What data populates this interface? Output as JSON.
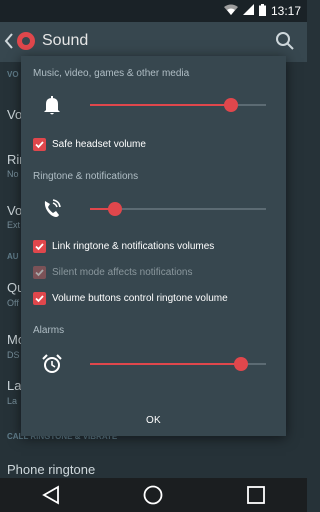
{
  "status_bar": {
    "time": "13:17"
  },
  "app_bar": {
    "title": "Sound"
  },
  "background_list": {
    "items": [
      {
        "label": "Vo",
        "top": 0
      },
      {
        "label": "Rin",
        "sub": "No"
      },
      {
        "label": "Vo",
        "sub": "Ext"
      },
      {
        "label": "Qu",
        "sub": "Off"
      },
      {
        "label": "Mo",
        "sub": "DS"
      },
      {
        "label": "La",
        "sub": "La"
      }
    ],
    "section_headers": [
      "VO",
      "AU",
      "CALL RINGTONE & VIBRATE"
    ],
    "phone_ringtone": "Phone ringtone"
  },
  "dialog": {
    "media": {
      "label": "Music, video, games & other media",
      "icon": "bell-icon",
      "level": 0.8
    },
    "safe_headset": {
      "label": "Safe headset volume",
      "checked": true
    },
    "ringtone": {
      "label": "Ringtone & notifications",
      "icon": "phone-ring-icon",
      "level": 0.14
    },
    "link_ringtone": {
      "label": "Link ringtone & notifications volumes",
      "checked": true
    },
    "silent_mode": {
      "label": "Silent mode affects notifications",
      "checked": true,
      "disabled": true
    },
    "volume_buttons": {
      "label": "Volume buttons control ringtone volume",
      "checked": true
    },
    "alarms": {
      "label": "Alarms",
      "icon": "alarm-clock-icon",
      "level": 0.86
    },
    "ok_label": "OK"
  },
  "colors": {
    "accent": "#e0474c",
    "dialog_bg": "#37474f",
    "app_bg": "#263238"
  }
}
